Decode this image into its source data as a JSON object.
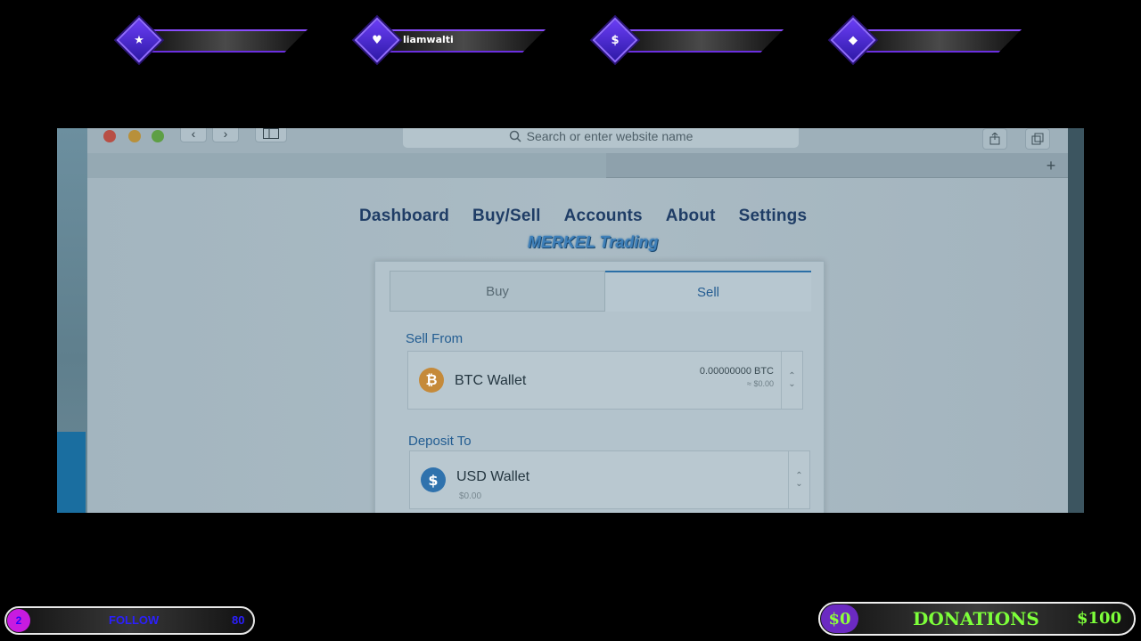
{
  "stream_overlay": {
    "top_widgets": [
      {
        "icon": "star-icon",
        "glyph": "★",
        "text": ""
      },
      {
        "icon": "heart-icon",
        "glyph": "♥",
        "text": "liamwalti"
      },
      {
        "icon": "dollar-icon",
        "glyph": "$",
        "text": ""
      },
      {
        "icon": "diamond-icon",
        "glyph": "◆",
        "text": ""
      }
    ],
    "follow": {
      "count": "2",
      "label": "FOLLOW",
      "goal": "80"
    },
    "donations": {
      "current": "$0",
      "label": "DONATIONS",
      "goal": "$100"
    }
  },
  "browser": {
    "url_placeholder": "Search or enter website name",
    "nav_back": "‹",
    "nav_forward": "›",
    "new_tab": "+"
  },
  "site": {
    "nav": [
      "Dashboard",
      "Buy/Sell",
      "Accounts",
      "About",
      "Settings"
    ],
    "brand": "MERKEL Trading",
    "tabs": {
      "buy": "Buy",
      "sell": "Sell",
      "selected": "Sell"
    },
    "sell_from": {
      "label": "Sell From",
      "wallet": "BTC Wallet",
      "amount": "0.00000000 BTC",
      "fiat": "≈ $0.00",
      "icon": "bitcoin-icon"
    },
    "deposit_to": {
      "label": "Deposit To",
      "wallet": "USD Wallet",
      "balance": "$0.00",
      "icon": "dollar-coin-icon"
    }
  },
  "colors": {
    "overlay_purple": "#6a3df5",
    "donation_green": "#7dff3a",
    "follow_blue": "#2b1fff",
    "site_nav": "#1f3d66",
    "site_link": "#235d92"
  }
}
